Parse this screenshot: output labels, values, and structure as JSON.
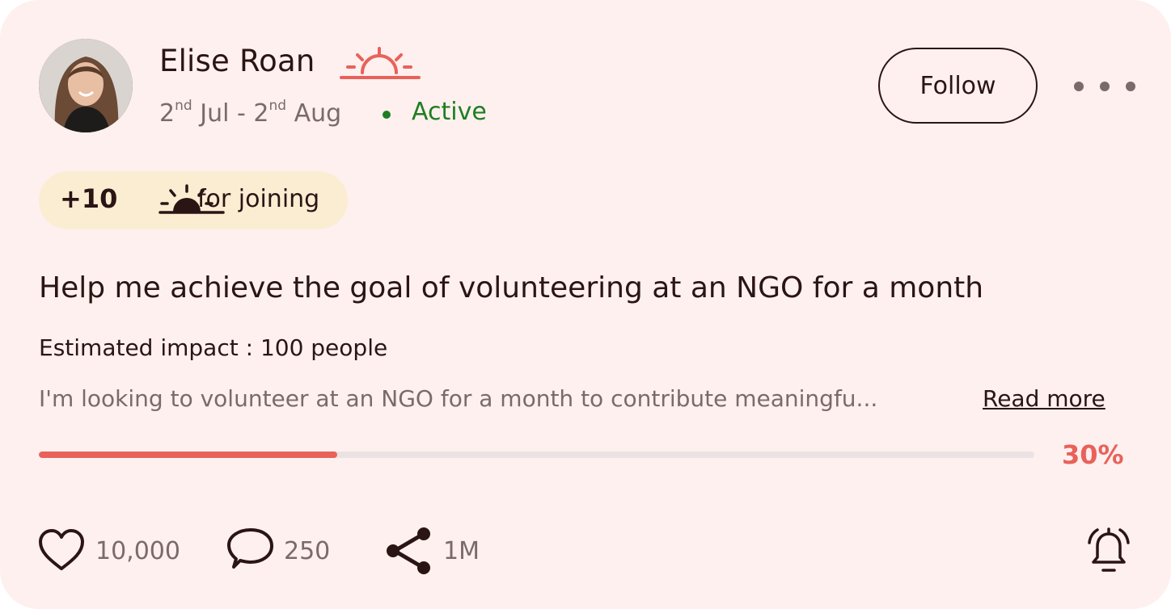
{
  "profile": {
    "name": "Elise Roan",
    "start_day": "2",
    "start_suffix": "nd",
    "start_month": "Jul",
    "separator": "-",
    "end_day": "2",
    "end_suffix": "nd",
    "end_month": "Aug",
    "status": "Active",
    "status_color": "#1f7d22"
  },
  "actions": {
    "follow_label": "Follow"
  },
  "reward": {
    "points": "+10",
    "label": "for joining"
  },
  "goal": {
    "title": "Help me achieve the goal of volunteering at an NGO for a month",
    "impact": "Estimated impact : 100 people",
    "description": "I'm looking to volunteer at an NGO for a month to contribute meaningfu...",
    "read_more": "Read more",
    "progress_label": "30%",
    "progress_fraction": 0.3
  },
  "stats": {
    "likes": "10,000",
    "comments": "250",
    "shares": "1M"
  },
  "icons": {
    "sun": "sun-rise-icon",
    "like": "heart-icon",
    "comment": "comment-icon",
    "share": "share-icon",
    "bell": "bell-icon",
    "more": "more-dots-icon"
  },
  "colors": {
    "accent": "#e8625a",
    "card_bg": "#fdf0ee",
    "reward_bg": "#fbedd2",
    "text": "#2b1414",
    "muted": "#7b6a6a"
  }
}
